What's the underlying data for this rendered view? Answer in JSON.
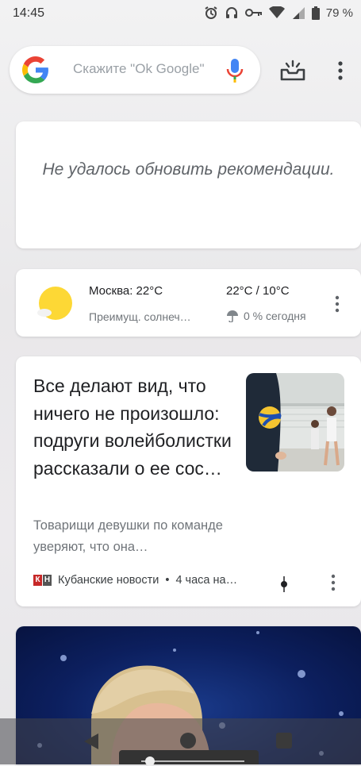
{
  "status_bar": {
    "time": "14:45",
    "battery_percent": "79 %"
  },
  "search": {
    "placeholder": "Скажите \"Ok Google\""
  },
  "error_card": {
    "message": "Не удалось обновить рекомендации."
  },
  "weather": {
    "city_temp": "Москва: 22°C",
    "condition": "Преимущ. солнеч…",
    "high_low": "22°C / 10°C",
    "precipitation": "0 % сегодня"
  },
  "news": {
    "title": "Все делают вид, что ничего не произошло: подруги волейболистки рассказали о ее сос…",
    "summary": "Товарищи девушки по команде уверяют, что она…",
    "source_logo_letters": [
      "К",
      "Н"
    ],
    "source": "Кубанские новости",
    "time_ago": "4 часа на…"
  },
  "colors": {
    "google_blue": "#4285F4",
    "google_red": "#EA4335",
    "google_yellow": "#FBBC05",
    "google_green": "#34A853",
    "sun_yellow": "#FDD835",
    "source_red": "#C62828"
  },
  "icons": [
    "alarm-icon",
    "headphones-icon",
    "vpn-key-icon",
    "wifi-icon",
    "signal-icon",
    "battery-icon",
    "google-logo-icon",
    "mic-icon",
    "updates-tray-icon",
    "more-vert-icon",
    "sun-icon",
    "umbrella-icon",
    "pin-icon",
    "back-icon",
    "home-icon",
    "recents-icon"
  ]
}
